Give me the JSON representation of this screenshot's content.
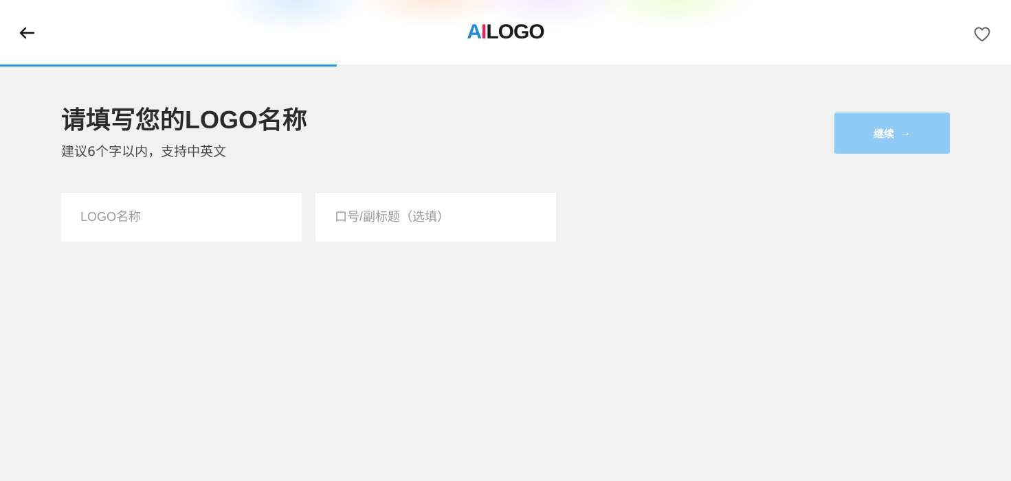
{
  "header": {
    "logo": {
      "part_a": "A",
      "part_i": "I",
      "rest": "LOGO"
    },
    "back_icon": "arrow-left-icon",
    "favorite_icon": "heart-outline-icon"
  },
  "progress": {
    "value_percent": 33.3
  },
  "main": {
    "title": "请填写您的LOGO名称",
    "subtitle": "建议6个字以内，支持中英文",
    "continue_label": "继续",
    "continue_arrow": "→",
    "name_field": {
      "placeholder": "LOGO名称",
      "value": ""
    },
    "slogan_field": {
      "placeholder": "口号/副标题（选填）",
      "value": ""
    }
  },
  "colors": {
    "accent": "#1e9bf0",
    "button_disabled": "#8ecbf7",
    "logo_a": "#1e88e5",
    "logo_i": "#e91e63",
    "background": "#f1f1f1"
  }
}
